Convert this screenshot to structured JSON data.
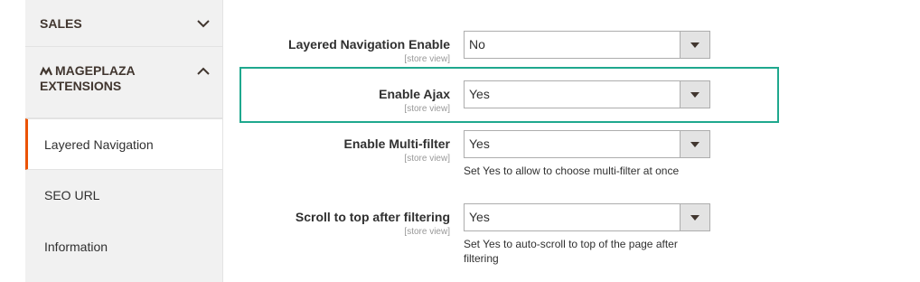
{
  "sidebar": {
    "sales_label": "SALES",
    "mageplaza_label_line1": "MAGEPLAZA",
    "mageplaza_label_line2": "EXTENSIONS",
    "items": [
      {
        "label": "Layered Navigation",
        "active": true
      },
      {
        "label": "SEO URL",
        "active": false
      },
      {
        "label": "Information",
        "active": false
      }
    ]
  },
  "fields": [
    {
      "label": "Layered Navigation Enable",
      "scope": "[store view]",
      "value": "No",
      "note": ""
    },
    {
      "label": "Enable Ajax",
      "scope": "[store view]",
      "value": "Yes",
      "note": ""
    },
    {
      "label": "Enable Multi-filter",
      "scope": "[store view]",
      "value": "Yes",
      "note": "Set Yes to allow to choose multi-filter at once"
    },
    {
      "label": "Scroll to top after filtering",
      "scope": "[store view]",
      "value": "Yes",
      "note": "Set Yes to auto-scroll to top of the page after filtering"
    }
  ],
  "colors": {
    "highlight_border": "#1fa88e",
    "active_accent": "#eb5202",
    "sidebar_bg": "#f1f1f1"
  },
  "icons": {
    "sales_toggle": "chevron-down-icon",
    "mageplaza_toggle": "chevron-up-icon",
    "mageplaza_logo": "mageplaza-logo-icon",
    "select_arrow": "dropdown-arrow-icon"
  }
}
